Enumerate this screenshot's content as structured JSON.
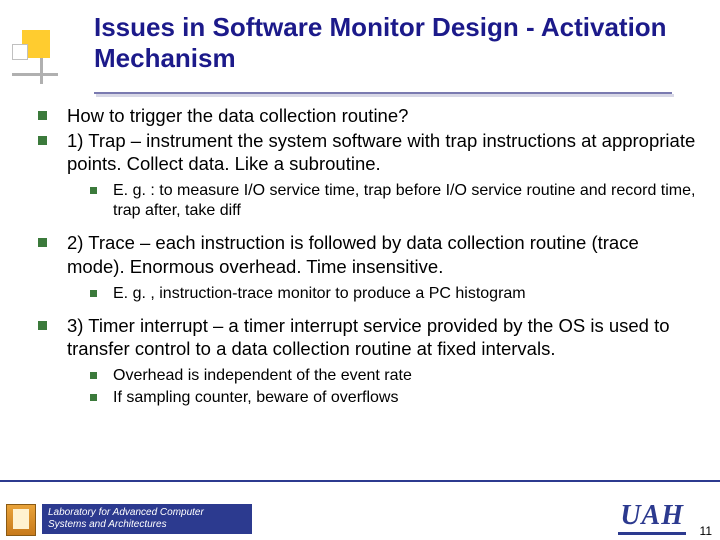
{
  "title": "Issues in Software Monitor Design - Activation Mechanism",
  "bullets": {
    "b1": "How to trigger the data collection routine?",
    "b2": "1) Trap – instrument the system software with trap instructions at appropriate points.  Collect data. Like a subroutine.",
    "b2a": "E. g. : to measure I/O service time, trap before I/O service routine and record time, trap after, take diff",
    "b3": "2) Trace – each instruction is followed by data collection routine (trace mode). Enormous overhead.  Time insensitive.",
    "b3a": "E. g. , instruction-trace monitor to produce a PC histogram",
    "b4": "3) Timer interrupt – a timer interrupt service provided by the OS is used to transfer control to a data collection routine at fixed intervals.",
    "b4a": "Overhead is independent of the event rate",
    "b4b": "If sampling counter, beware of overflows"
  },
  "footer": {
    "lab_line1": "Laboratory for Advanced Computer",
    "lab_line2": "Systems and Architectures",
    "uah": "UAH",
    "page": "11"
  }
}
